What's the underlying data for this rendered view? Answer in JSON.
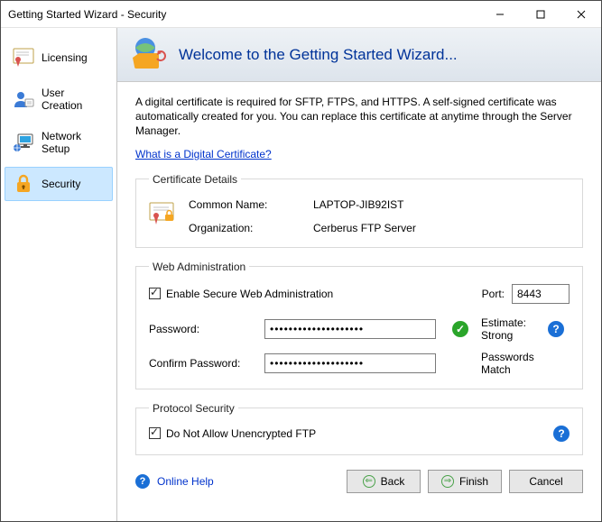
{
  "window": {
    "title": "Getting Started Wizard - Security"
  },
  "nav": {
    "items": [
      {
        "label": "Licensing"
      },
      {
        "label": "User Creation"
      },
      {
        "label": "Network Setup"
      },
      {
        "label": "Security"
      }
    ]
  },
  "header": {
    "title": "Welcome to the Getting Started Wizard..."
  },
  "intro": {
    "text": "A digital certificate is required for SFTP, FTPS, and HTTPS.  A self-signed certificate was automatically created for you.  You can replace this certificate at anytime through the Server Manager.",
    "link": "What is a Digital Certificate?"
  },
  "cert": {
    "legend": "Certificate Details",
    "cn_label": "Common Name:",
    "cn_value": "LAPTOP-JIB92IST",
    "org_label": "Organization:",
    "org_value": "Cerberus FTP Server"
  },
  "web": {
    "legend": "Web Administration",
    "enable_label": "Enable Secure Web Administration",
    "port_label": "Port:",
    "port_value": "8443",
    "password_label": "Password:",
    "password_value": "••••••••••••••••••••",
    "confirm_label": "Confirm Password:",
    "confirm_value": "••••••••••••••••••••",
    "estimate": "Estimate: Strong",
    "match": "Passwords Match"
  },
  "proto": {
    "legend": "Protocol Security",
    "no_plain_ftp": "Do Not Allow Unencrypted FTP"
  },
  "footer": {
    "help": "Online Help",
    "back": "Back",
    "finish": "Finish",
    "cancel": "Cancel"
  }
}
